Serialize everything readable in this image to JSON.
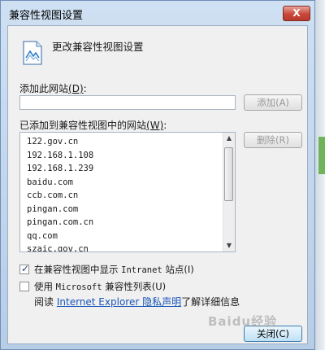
{
  "window": {
    "title": "兼容性视图设置",
    "close_glyph": "X"
  },
  "header": {
    "text": "更改兼容性视图设置",
    "icon": "compatibility-view-icon"
  },
  "add_section": {
    "label_prefix": "添加此网站",
    "label_key": "(D)",
    "label_suffix": ":",
    "input_value": "",
    "add_button_label": "添加(A)"
  },
  "list_section": {
    "label_prefix": "已添加到兼容性视图中的网站",
    "label_key": "(W)",
    "label_suffix": ":",
    "sites": [
      "122.gov.cn",
      "192.168.1.108",
      "192.168.1.239",
      "baidu.com",
      "ccb.com.cn",
      "pingan.com",
      "pingan.com.cn",
      "qq.com",
      "szaic.gov.cn"
    ],
    "remove_button_label": "删除(R)"
  },
  "options": {
    "intranet": {
      "checked": true,
      "label_cn": "在兼容性视图中显示",
      "label_latin": "Intranet",
      "label_tail": "站点(I)"
    },
    "ms_list": {
      "checked": false,
      "label_cn": "使用",
      "label_latin": "Microsoft",
      "label_tail": "兼容性列表(U)"
    }
  },
  "privacy": {
    "prefix": "阅读",
    "link_text": "Internet Explorer 隐私声明",
    "suffix": "了解详细信息"
  },
  "footer": {
    "close_button_label": "关闭(C)"
  },
  "watermark": "Baidu经验",
  "colors": {
    "title_bar": "#cfe0f3",
    "close_red": "#c9473a",
    "link_blue": "#1a56b8",
    "primary_button": "#bfe1f6"
  }
}
